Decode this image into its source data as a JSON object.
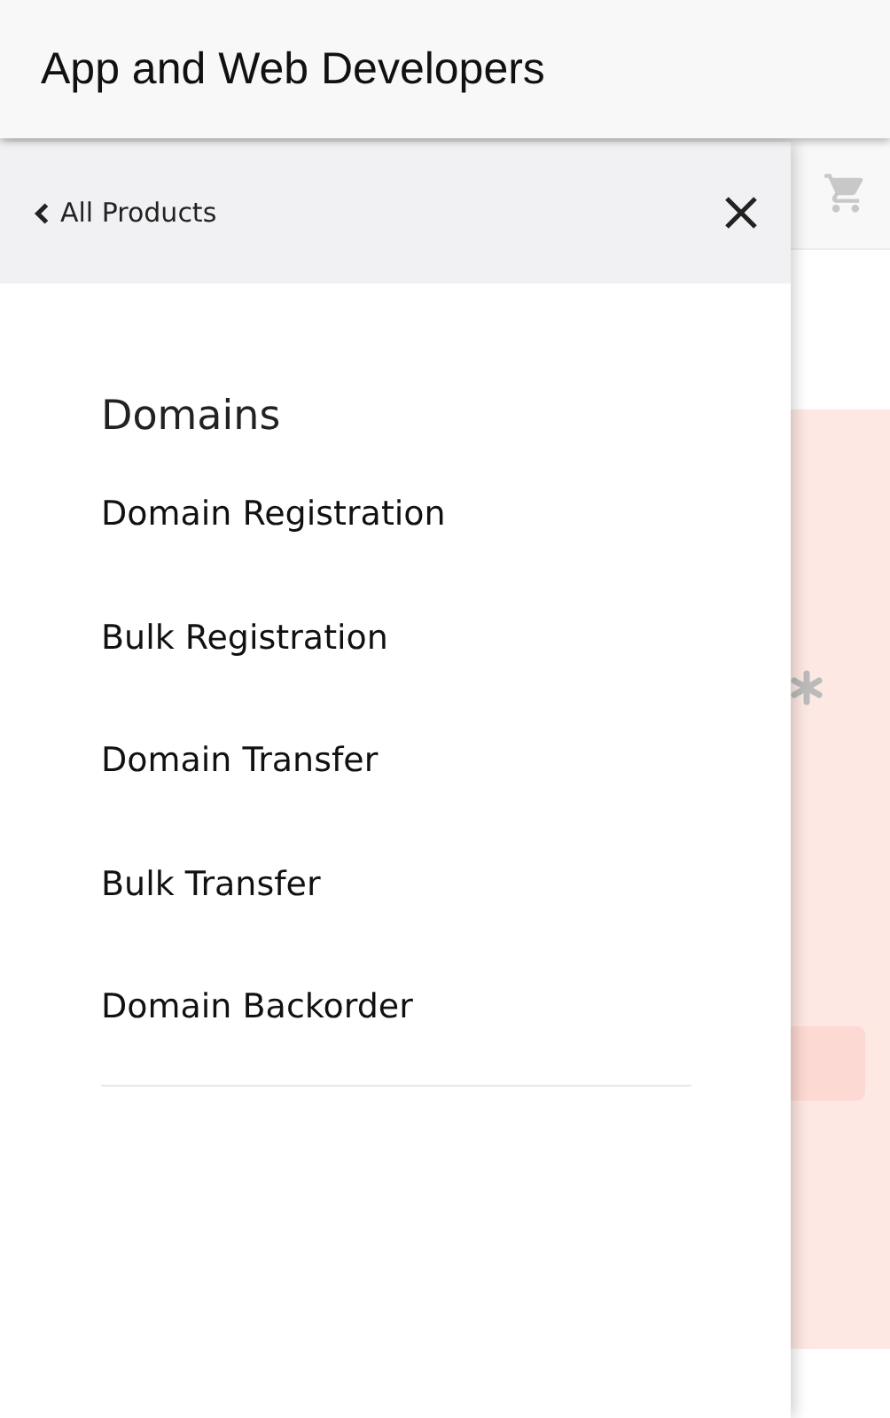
{
  "app_bar": {
    "title": "App and Web Developers"
  },
  "drawer": {
    "back_link": "All Products",
    "section_title": "Domains",
    "items": [
      "Domain Registration",
      "Bulk Registration",
      "Domain Transfer",
      "Bulk Transfer",
      "Domain Backorder"
    ]
  }
}
